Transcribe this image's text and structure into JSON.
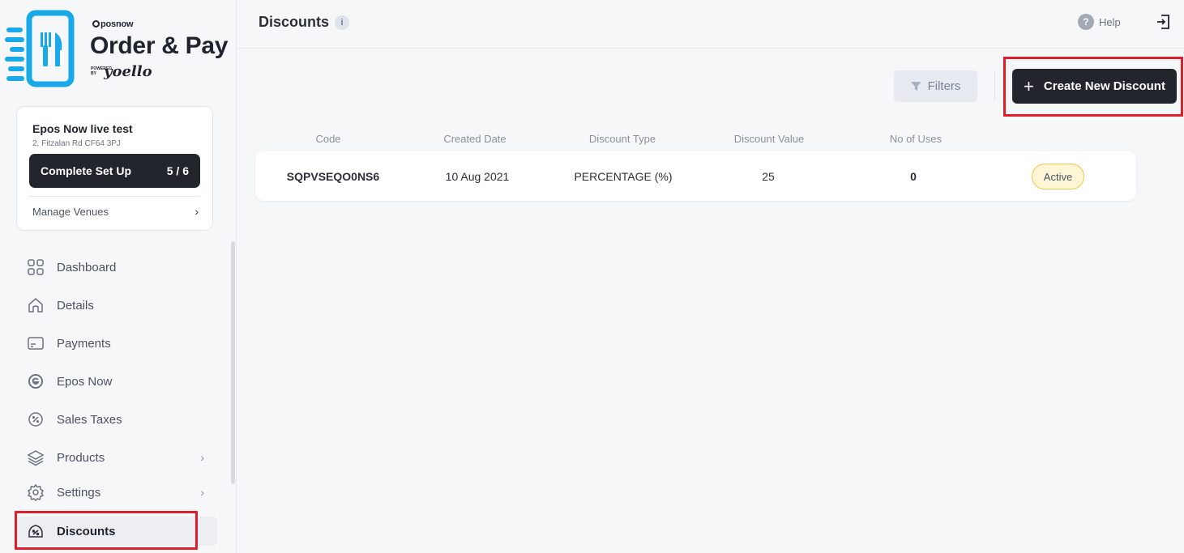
{
  "brand": {
    "small": "posnow",
    "title": "Order & Pay",
    "powered": "POWERED BY",
    "partner": "yoello"
  },
  "venue": {
    "name": "Epos Now live test",
    "address": "2, Fitzalan Rd CF64 3PJ",
    "setup_label": "Complete Set Up",
    "setup_progress": "5 / 6",
    "manage_label": "Manage Venues"
  },
  "nav": {
    "items": [
      {
        "label": "Dashboard",
        "icon": "grid-icon"
      },
      {
        "label": "Details",
        "icon": "home-icon"
      },
      {
        "label": "Payments",
        "icon": "card-icon"
      },
      {
        "label": "Epos Now",
        "icon": "epos-icon"
      },
      {
        "label": "Sales Taxes",
        "icon": "percent-circle-icon"
      },
      {
        "label": "Products",
        "icon": "layers-icon"
      },
      {
        "label": "Settings",
        "icon": "gear-icon"
      },
      {
        "label": "Discounts",
        "icon": "discount-tag-icon"
      }
    ]
  },
  "header": {
    "title": "Discounts",
    "info": "i",
    "help_symbol": "?",
    "help_label": "Help"
  },
  "toolbar": {
    "filters_label": "Filters",
    "create_plus": "+",
    "create_label": "Create New Discount"
  },
  "table": {
    "columns": [
      "Code",
      "Created Date",
      "Discount Type",
      "Discount Value",
      "No of Uses"
    ],
    "rows": [
      {
        "code": "SQPVSEQO0NS6",
        "created_date": "10 Aug 2021",
        "discount_type": "PERCENTAGE (%)",
        "discount_value": "25",
        "uses": "0",
        "status": "Active"
      }
    ]
  },
  "colors": {
    "primary_dark": "#23252d",
    "brand_blue": "#19a8e8",
    "highlight_red": "#e11d2a",
    "active_badge_bg": "#fdf6d6",
    "active_badge_border": "#e8c84a"
  }
}
